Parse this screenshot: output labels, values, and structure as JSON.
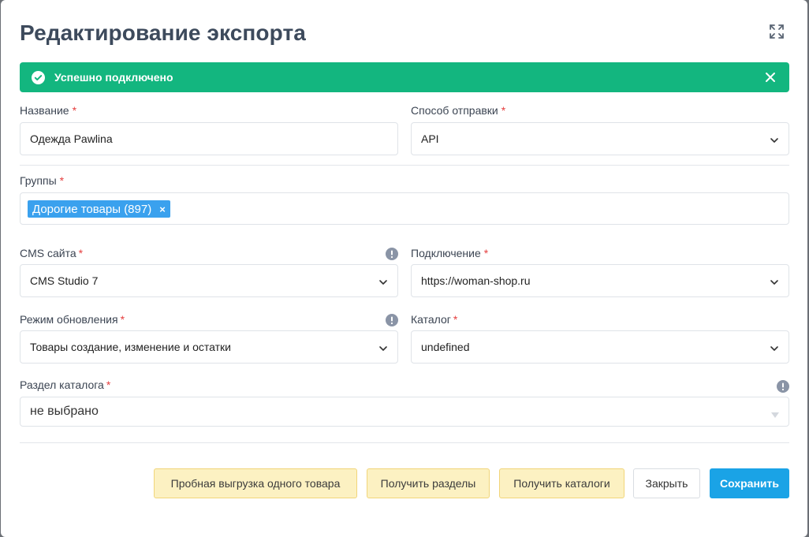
{
  "modal": {
    "title": "Редактирование экспорта"
  },
  "alert": {
    "message": "Успешно подключено"
  },
  "fields": {
    "name": {
      "label": "Название",
      "value": "Одежда Pawlina"
    },
    "send_method": {
      "label": "Способ отправки",
      "value": "API"
    },
    "groups": {
      "label": "Группы",
      "tags": [
        "Дорогие товары (897)"
      ],
      "tag_remove": "×"
    },
    "cms": {
      "label": "CMS сайта",
      "value": "CMS Studio 7"
    },
    "connection": {
      "label": "Подключение",
      "value": "https://woman-shop.ru"
    },
    "update_mode": {
      "label": "Режим обновления",
      "value": "Товары создание, изменение и остатки"
    },
    "catalog": {
      "label": "Каталог",
      "value": "undefined"
    },
    "catalog_section": {
      "label": "Раздел каталога",
      "value": "не выбрано"
    }
  },
  "buttons": {
    "test_export": "Пробная выгрузка одного товара",
    "get_sections": "Получить разделы",
    "get_catalogs": "Получить каталоги",
    "close": "Закрыть",
    "save": "Сохранить"
  },
  "colors": {
    "success": "#13b67f",
    "primary": "#1aa3e6",
    "tag": "#3aa1ee",
    "warning_btn": "#fcf1c2",
    "required": "#e53e3e"
  },
  "icons": [
    "expand-icon",
    "check-circle-icon",
    "close-icon",
    "chevron-down-icon",
    "info-icon",
    "caret-down-icon"
  ]
}
